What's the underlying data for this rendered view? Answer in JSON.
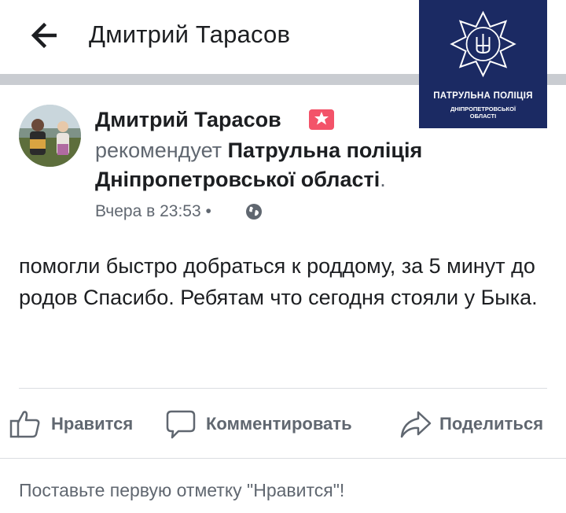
{
  "appbar": {
    "title": "Дмитрий Тарасов",
    "back_icon": "arrow-left-icon"
  },
  "badge": {
    "line1": "ПАТРУЛЬНА ПОЛІЦІЯ",
    "line2a": "ДНІПРОПЕТРОВСЬКОЇ",
    "line2b": "ОБЛАСТІ",
    "color": "#1b2a63"
  },
  "post": {
    "author": "Дмитрий Тарасов",
    "verb": "рекомендует",
    "page_line1": "Патрульна поліція",
    "page_line2": "Дніпропетровської області",
    "period": ".",
    "timestamp": "Вчера в 23:53",
    "separator": "•",
    "privacy_icon": "globe-icon",
    "text": "помогли быстро добраться к роддому, за 5 минут до родов Спасибо. Ребятам что сегодня стояли у Быка.",
    "star_color": "#f35369"
  },
  "actions": {
    "like": "Нравится",
    "comment": "Комментировать",
    "share": "Поделиться"
  },
  "likes_prompt": "Поставьте первую отметку \"Нравится\"!"
}
